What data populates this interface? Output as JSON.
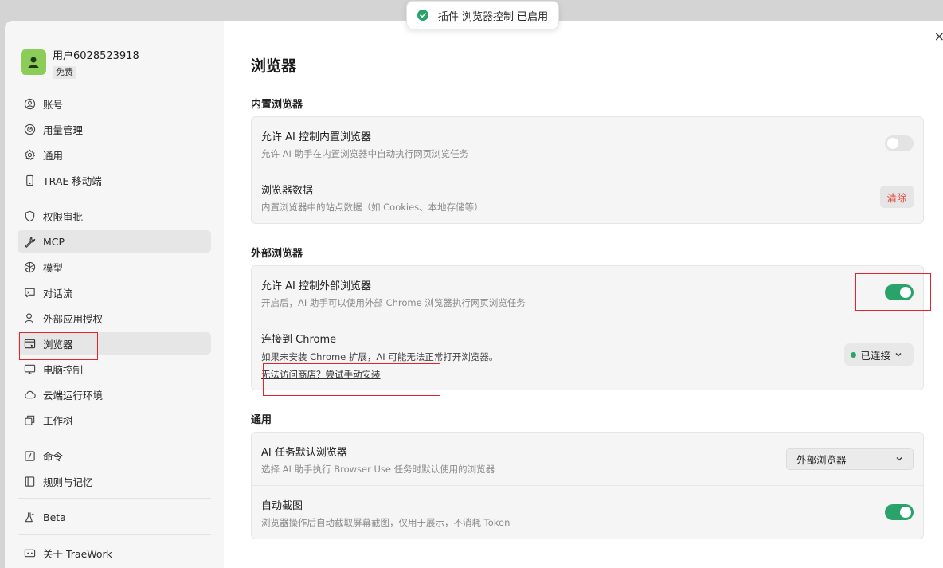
{
  "toast": {
    "text": "插件 浏览器控制 已启用",
    "icon": "check-circle-icon"
  },
  "close_icon": "×",
  "user": {
    "name": "用户6028523918",
    "plan": "免费"
  },
  "sidebar": {
    "groups": [
      [
        {
          "label": "账号",
          "icon": "user-circle-icon"
        },
        {
          "label": "用量管理",
          "icon": "gauge-icon"
        },
        {
          "label": "通用",
          "icon": "gear-icon"
        },
        {
          "label": "TRAE 移动端",
          "icon": "phone-icon"
        }
      ],
      [
        {
          "label": "权限审批",
          "icon": "shield-icon"
        },
        {
          "label": "MCP",
          "icon": "wrench-icon",
          "active": true
        },
        {
          "label": "模型",
          "icon": "cube-icon"
        },
        {
          "label": "对话流",
          "icon": "chat-icon"
        },
        {
          "label": "外部应用授权",
          "icon": "user-key-icon"
        },
        {
          "label": "浏览器",
          "icon": "browser-icon",
          "selected": true
        },
        {
          "label": "电脑控制",
          "icon": "monitor-icon"
        },
        {
          "label": "云端运行环境",
          "icon": "cloud-icon"
        },
        {
          "label": "工作树",
          "icon": "tree-icon"
        }
      ],
      [
        {
          "label": "命令",
          "icon": "slash-command-icon"
        },
        {
          "label": "规则与记忆",
          "icon": "book-icon"
        }
      ],
      [
        {
          "label": "Beta",
          "icon": "flask-icon"
        }
      ],
      [
        {
          "label": "关于 TraeWork",
          "icon": "info-icon"
        }
      ]
    ]
  },
  "main": {
    "title": "浏览器",
    "sections": {
      "builtin": {
        "title": "内置浏览器",
        "allow_ai": {
          "title": "允许 AI 控制内置浏览器",
          "desc": "允许 AI 助手在内置浏览器中自动执行网页浏览任务",
          "enabled": false
        },
        "data": {
          "title": "浏览器数据",
          "desc": "内置浏览器中的站点数据（如 Cookies、本地存储等）",
          "button": "清除"
        }
      },
      "external": {
        "title": "外部浏览器",
        "allow_ai": {
          "title": "允许 AI 控制外部浏览器",
          "desc": "开启后，AI 助手可以使用外部 Chrome 浏览器执行网页浏览任务",
          "enabled": true
        },
        "connect": {
          "title": "连接到 Chrome",
          "desc": "如果未安装 Chrome 扩展，AI 可能无法正常打开浏览器。",
          "link": "无法访问商店？尝试手动安装",
          "status": "已连接"
        }
      },
      "general": {
        "title": "通用",
        "default_browser": {
          "title": "AI 任务默认浏览器",
          "desc": "选择 AI 助手执行 Browser Use 任务时默认使用的浏览器",
          "value": "外部浏览器"
        },
        "auto_screenshot": {
          "title": "自动截图",
          "desc": "浏览器操作后自动截取屏幕截图，仅用于展示，不消耗 Token",
          "enabled": true
        }
      }
    }
  },
  "colors": {
    "accent_green": "#2aa36b",
    "danger": "#e2483d",
    "highlight": "#e0262b"
  }
}
